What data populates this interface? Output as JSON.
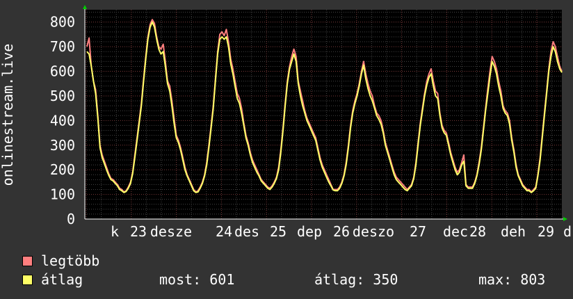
{
  "chart_data": {
    "type": "line",
    "ylabel": "onlinestream.live",
    "ylim": [
      0,
      850
    ],
    "yticks": [
      0,
      100,
      200,
      300,
      400,
      500,
      600,
      700,
      800
    ],
    "x_tick_labels": [
      "k",
      "23",
      "desze",
      "24",
      "des",
      "25",
      "dep",
      "26",
      "deszo",
      "27",
      "dec",
      "28",
      "deh",
      "29",
      "d"
    ],
    "grid": true,
    "series": [
      {
        "name": "legtöbb",
        "color": "#ff7f7f",
        "values": [
          700,
          735,
          620,
          560,
          525,
          420,
          300,
          260,
          235,
          210,
          185,
          165,
          160,
          150,
          140,
          125,
          120,
          110,
          115,
          130,
          150,
          190,
          260,
          330,
          400,
          470,
          570,
          660,
          740,
          790,
          810,
          795,
          740,
          700,
          690,
          710,
          640,
          560,
          540,
          480,
          410,
          340,
          320,
          290,
          250,
          210,
          180,
          160,
          140,
          120,
          110,
          115,
          130,
          150,
          180,
          230,
          300,
          380,
          460,
          570,
          680,
          750,
          760,
          745,
          770,
          720,
          650,
          610,
          560,
          510,
          490,
          450,
          390,
          340,
          310,
          270,
          240,
          220,
          200,
          180,
          160,
          150,
          140,
          130,
          125,
          135,
          150,
          170,
          210,
          280,
          370,
          470,
          560,
          620,
          660,
          690,
          660,
          560,
          520,
          480,
          440,
          410,
          390,
          370,
          350,
          330,
          290,
          250,
          220,
          200,
          180,
          160,
          140,
          120,
          120,
          120,
          130,
          150,
          180,
          230,
          300,
          380,
          440,
          480,
          510,
          550,
          600,
          640,
          590,
          550,
          520,
          500,
          460,
          430,
          420,
          400,
          360,
          310,
          280,
          250,
          220,
          190,
          170,
          160,
          150,
          140,
          130,
          120,
          130,
          140,
          170,
          230,
          310,
          390,
          450,
          510,
          560,
          590,
          610,
          560,
          520,
          510,
          430,
          380,
          360,
          350,
          310,
          270,
          240,
          210,
          190,
          200,
          230,
          260,
          140,
          130,
          130,
          130,
          150,
          180,
          230,
          290,
          370,
          450,
          530,
          600,
          660,
          640,
          610,
          560,
          520,
          460,
          440,
          430,
          400,
          330,
          280,
          220,
          180,
          160,
          140,
          130,
          120,
          120,
          110,
          120,
          130,
          180,
          250,
          340,
          430,
          520,
          610,
          680,
          720,
          700,
          660,
          620,
          600
        ]
      },
      {
        "name": "átlag",
        "color": "#ffff66",
        "values": [
          680,
          670,
          620,
          560,
          510,
          410,
          290,
          250,
          225,
          200,
          178,
          160,
          155,
          145,
          135,
          120,
          115,
          108,
          112,
          125,
          145,
          185,
          250,
          320,
          390,
          460,
          560,
          650,
          730,
          780,
          800,
          780,
          730,
          690,
          670,
          680,
          620,
          550,
          520,
          460,
          390,
          330,
          310,
          280,
          240,
          200,
          175,
          155,
          135,
          115,
          108,
          110,
          125,
          145,
          175,
          220,
          290,
          370,
          450,
          560,
          670,
          730,
          740,
          730,
          740,
          700,
          630,
          590,
          540,
          490,
          470,
          430,
          380,
          330,
          300,
          260,
          230,
          210,
          190,
          175,
          155,
          145,
          135,
          125,
          120,
          130,
          145,
          165,
          200,
          270,
          360,
          460,
          550,
          610,
          640,
          670,
          640,
          550,
          500,
          460,
          430,
          400,
          380,
          360,
          340,
          320,
          280,
          240,
          210,
          190,
          170,
          150,
          135,
          118,
          115,
          115,
          125,
          145,
          175,
          220,
          290,
          370,
          430,
          470,
          500,
          540,
          590,
          625,
          570,
          530,
          500,
          480,
          450,
          420,
          405,
          385,
          350,
          300,
          270,
          240,
          210,
          180,
          160,
          150,
          140,
          130,
          120,
          115,
          125,
          135,
          165,
          220,
          300,
          380,
          440,
          500,
          545,
          575,
          590,
          540,
          500,
          490,
          420,
          370,
          350,
          340,
          300,
          260,
          230,
          200,
          180,
          190,
          220,
          235,
          135,
          125,
          125,
          125,
          145,
          175,
          220,
          280,
          360,
          440,
          510,
          580,
          640,
          620,
          590,
          540,
          500,
          450,
          430,
          420,
          385,
          320,
          270,
          210,
          175,
          155,
          135,
          125,
          115,
          115,
          108,
          115,
          125,
          175,
          240,
          330,
          420,
          510,
          600,
          660,
          700,
          680,
          640,
          610,
          595
        ]
      }
    ]
  },
  "legend": [
    {
      "label": "legtöbb",
      "color": "#ff7f7f"
    },
    {
      "label": "átlag",
      "color": "#ffff66"
    }
  ],
  "stats": {
    "most_label": "most:",
    "most_value": "601",
    "avg_label": "átlag:",
    "avg_value": "350",
    "max_label": "max:",
    "max_value": "803"
  }
}
